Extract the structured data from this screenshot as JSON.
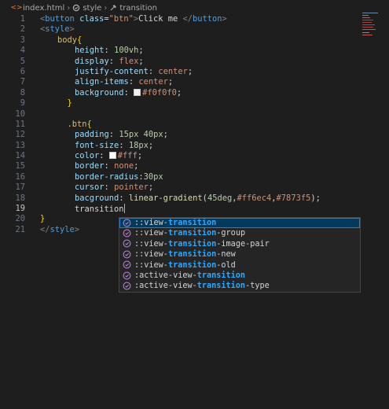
{
  "breadcrumb": {
    "file": "index.html",
    "element": "style",
    "property": "transition"
  },
  "colors": {
    "background": "#1e1e1e",
    "suggest_bg": "#252526",
    "suggest_selected": "#04395e",
    "match_highlight": "#2aaaff",
    "html_icon": "#e37933",
    "property_icon": "#b180d7"
  },
  "editor": {
    "lines": [
      {
        "n": "1",
        "tokens": [
          {
            "t": "<",
            "c": "t-bracket"
          },
          {
            "t": "button",
            "c": "t-tag"
          },
          {
            "t": " ",
            "c": "t-text"
          },
          {
            "t": "class",
            "c": "t-attr"
          },
          {
            "t": "=",
            "c": "t-text"
          },
          {
            "t": "\"btn\"",
            "c": "t-str"
          },
          {
            "t": ">",
            "c": "t-bracket"
          },
          {
            "t": "Click me ",
            "c": "t-text"
          },
          {
            "t": "</",
            "c": "t-bracket"
          },
          {
            "t": "button",
            "c": "t-tag"
          },
          {
            "t": ">",
            "c": "t-bracket"
          }
        ]
      },
      {
        "n": "2",
        "tokens": [
          {
            "t": "<",
            "c": "t-bracket"
          },
          {
            "t": "style",
            "c": "t-tag"
          },
          {
            "t": ">",
            "c": "t-bracket"
          }
        ]
      },
      {
        "n": "3",
        "indent": "indent1",
        "tokens": [
          {
            "t": "body",
            "c": "t-sel"
          },
          {
            "t": "{",
            "c": "t-brace"
          }
        ]
      },
      {
        "n": "4",
        "indent": "indent2",
        "tokens": [
          {
            "t": "height",
            "c": "t-prop"
          },
          {
            "t": ": ",
            "c": "t-punct"
          },
          {
            "t": "100vh",
            "c": "t-num"
          },
          {
            "t": ";",
            "c": "t-punct"
          }
        ]
      },
      {
        "n": "5",
        "indent": "indent2",
        "tokens": [
          {
            "t": "display",
            "c": "t-prop"
          },
          {
            "t": ": ",
            "c": "t-punct"
          },
          {
            "t": "flex",
            "c": "t-val"
          },
          {
            "t": ";",
            "c": "t-punct"
          }
        ]
      },
      {
        "n": "6",
        "indent": "indent2",
        "tokens": [
          {
            "t": "justify-content",
            "c": "t-prop"
          },
          {
            "t": ": ",
            "c": "t-punct"
          },
          {
            "t": "center",
            "c": "t-val"
          },
          {
            "t": ";",
            "c": "t-punct"
          }
        ]
      },
      {
        "n": "7",
        "indent": "indent2",
        "tokens": [
          {
            "t": "align-items",
            "c": "t-prop"
          },
          {
            "t": ": ",
            "c": "t-punct"
          },
          {
            "t": "center",
            "c": "t-val"
          },
          {
            "t": ";",
            "c": "t-punct"
          }
        ]
      },
      {
        "n": "8",
        "indent": "indent2",
        "tokens": [
          {
            "t": "background",
            "c": "t-prop"
          },
          {
            "t": ": ",
            "c": "t-punct"
          },
          {
            "swatch": "#f0f0f0"
          },
          {
            "t": "#f0f0f0",
            "c": "t-val"
          },
          {
            "t": ";",
            "c": "t-punct"
          }
        ]
      },
      {
        "n": "9",
        "indent": "indent1",
        "tokens": [
          {
            "t": "  }",
            "c": "t-brace"
          }
        ]
      },
      {
        "n": "10",
        "tokens": []
      },
      {
        "n": "11",
        "indent": "indent1",
        "tokens": [
          {
            "t": "  .btn",
            "c": "t-sel"
          },
          {
            "t": "{",
            "c": "t-brace"
          }
        ]
      },
      {
        "n": "12",
        "indent": "indent2",
        "tokens": [
          {
            "t": "padding",
            "c": "t-prop"
          },
          {
            "t": ": ",
            "c": "t-punct"
          },
          {
            "t": "15px 40px",
            "c": "t-num"
          },
          {
            "t": ";",
            "c": "t-punct"
          }
        ]
      },
      {
        "n": "13",
        "indent": "indent2",
        "tokens": [
          {
            "t": "font-size",
            "c": "t-prop"
          },
          {
            "t": ": ",
            "c": "t-punct"
          },
          {
            "t": "18px",
            "c": "t-num"
          },
          {
            "t": ";",
            "c": "t-punct"
          }
        ]
      },
      {
        "n": "14",
        "indent": "indent2",
        "tokens": [
          {
            "t": "color",
            "c": "t-prop"
          },
          {
            "t": ": ",
            "c": "t-punct"
          },
          {
            "swatch": "#ffffff"
          },
          {
            "t": "#fff",
            "c": "t-val"
          },
          {
            "t": ";",
            "c": "t-punct"
          }
        ]
      },
      {
        "n": "15",
        "indent": "indent2",
        "tokens": [
          {
            "t": "border",
            "c": "t-prop"
          },
          {
            "t": ": ",
            "c": "t-punct"
          },
          {
            "t": "none",
            "c": "t-val"
          },
          {
            "t": ";",
            "c": "t-punct"
          }
        ]
      },
      {
        "n": "16",
        "indent": "indent2",
        "tokens": [
          {
            "t": "border-radius",
            "c": "t-prop"
          },
          {
            "t": ":",
            "c": "t-punct"
          },
          {
            "t": "30px",
            "c": "t-num"
          }
        ]
      },
      {
        "n": "17",
        "indent": "indent2",
        "tokens": [
          {
            "t": "cursor",
            "c": "t-prop"
          },
          {
            "t": ": ",
            "c": "t-punct"
          },
          {
            "t": "pointer",
            "c": "t-val"
          },
          {
            "t": ";",
            "c": "t-punct"
          }
        ]
      },
      {
        "n": "18",
        "indent": "indent2",
        "tokens": [
          {
            "t": "bacground",
            "c": "t-prop"
          },
          {
            "t": ": ",
            "c": "t-punct"
          },
          {
            "t": "linear-gradient",
            "c": "t-fn"
          },
          {
            "t": "(",
            "c": "t-punct"
          },
          {
            "t": "45deg",
            "c": "t-num"
          },
          {
            "t": ",",
            "c": "t-punct"
          },
          {
            "t": "#ff6ec4",
            "c": "t-val"
          },
          {
            "t": ",",
            "c": "t-punct"
          },
          {
            "t": "#7873f5",
            "c": "t-val"
          },
          {
            "t": ");",
            "c": "t-punct"
          }
        ]
      },
      {
        "n": "19",
        "indent": "indent2",
        "active": true,
        "tokens": [
          {
            "t": "transition",
            "c": "t-text"
          },
          {
            "cursor": true
          }
        ]
      },
      {
        "n": "20",
        "tokens": [
          {
            "t": "}",
            "c": "t-brace"
          }
        ]
      },
      {
        "n": "21",
        "tokens": [
          {
            "t": "</",
            "c": "t-bracket"
          },
          {
            "t": "style",
            "c": "t-tag"
          },
          {
            "t": ">",
            "c": "t-bracket"
          }
        ]
      }
    ]
  },
  "suggestions": [
    {
      "pre": "::view-",
      "match": "transition",
      "post": "",
      "selected": true
    },
    {
      "pre": "::view-",
      "match": "transition",
      "post": "-group"
    },
    {
      "pre": "::view-",
      "match": "transition",
      "post": "-image-pair"
    },
    {
      "pre": "::view-",
      "match": "transition",
      "post": "-new"
    },
    {
      "pre": "::view-",
      "match": "transition",
      "post": "-old"
    },
    {
      "pre": ":active-view-",
      "match": "transition",
      "post": ""
    },
    {
      "pre": ":active-view-",
      "match": "transition",
      "post": "-type"
    }
  ]
}
